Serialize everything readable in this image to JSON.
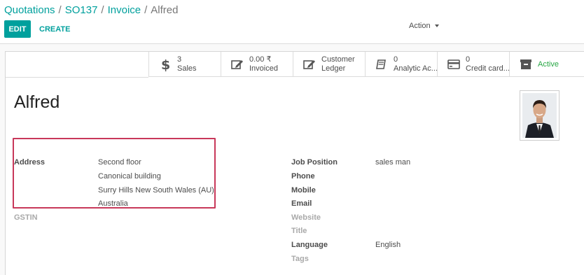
{
  "breadcrumb": {
    "items": [
      "Quotations",
      "SO137",
      "Invoice"
    ],
    "separator": "/",
    "current": "Alfred"
  },
  "toolbar": {
    "edit_label": "EDIT",
    "create_label": "CREATE",
    "action_label": "Action"
  },
  "stat_buttons": [
    {
      "icon": "dollar-icon",
      "value": "3",
      "label": "Sales"
    },
    {
      "icon": "edit-icon",
      "value": "0.00 ₹",
      "label": "Invoiced"
    },
    {
      "icon": "edit-icon",
      "value": "Customer",
      "label": "Ledger"
    },
    {
      "icon": "book-icon",
      "value": "0",
      "label": "Analytic Ac..."
    },
    {
      "icon": "credit-card-icon",
      "value": "0",
      "label": "Credit card..."
    },
    {
      "icon": "archive-icon",
      "value": "",
      "label": "Active"
    }
  ],
  "partner": {
    "name": "Alfred"
  },
  "address": {
    "label": "Address",
    "lines": [
      "Second floor",
      "Canonical building",
      "Surry Hills New South Wales (AU)",
      "Australia"
    ]
  },
  "gstin": {
    "label": "GSTIN",
    "value": ""
  },
  "right_fields": {
    "job_position": {
      "label": "Job Position",
      "value": "sales man"
    },
    "phone": {
      "label": "Phone",
      "value": ""
    },
    "mobile": {
      "label": "Mobile",
      "value": ""
    },
    "email": {
      "label": "Email",
      "value": ""
    },
    "website": {
      "label": "Website",
      "value": ""
    },
    "title": {
      "label": "Title",
      "value": ""
    },
    "language": {
      "label": "Language",
      "value": "English"
    },
    "tags": {
      "label": "Tags",
      "value": ""
    }
  },
  "colors": {
    "accent": "#00a09d",
    "active_green": "#28a745",
    "highlight_border": "#c8385a"
  }
}
